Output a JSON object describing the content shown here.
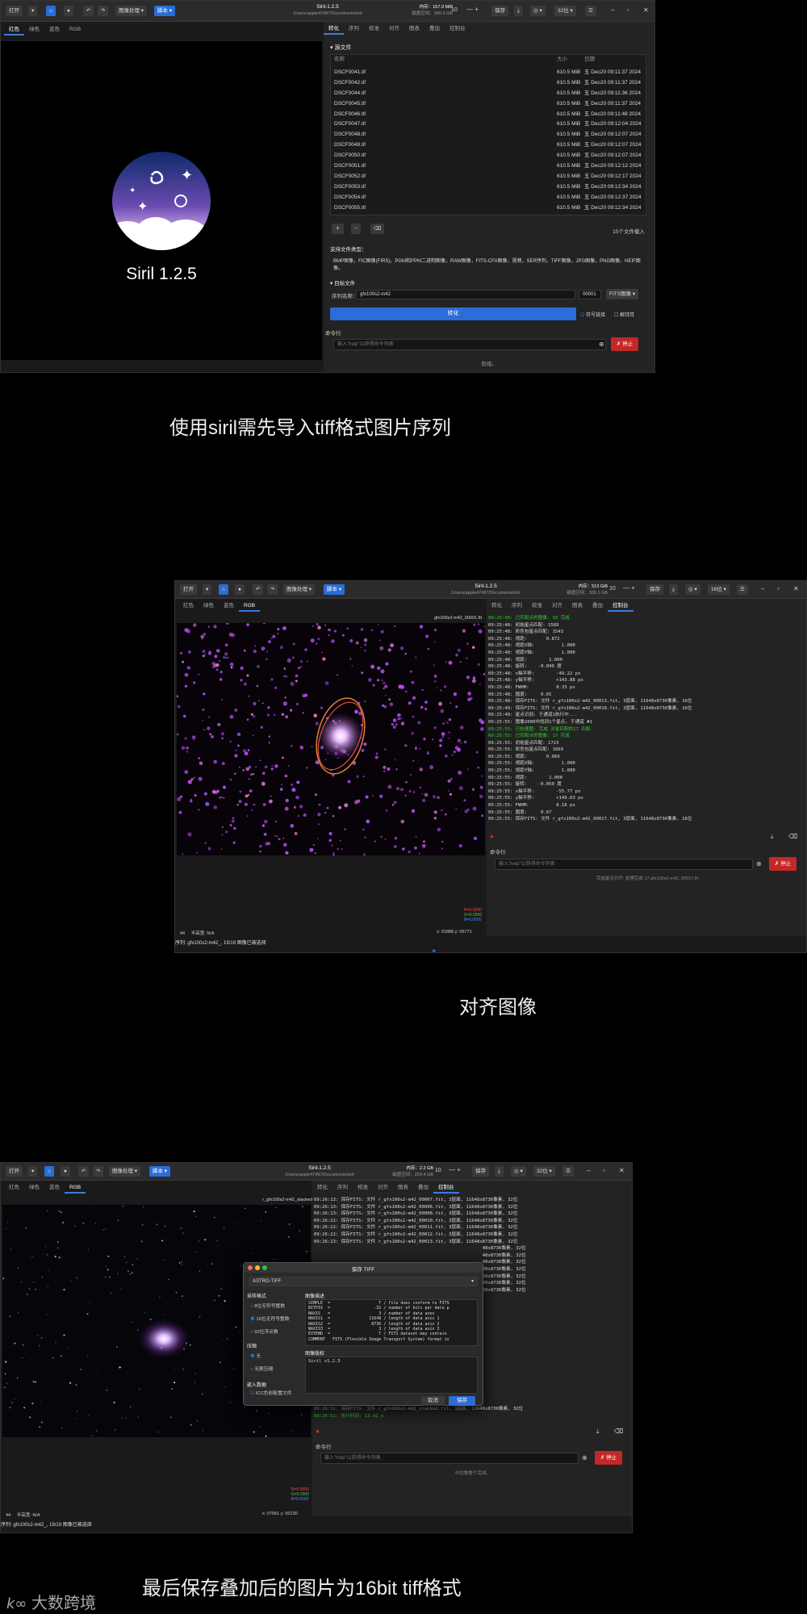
{
  "shared": {
    "open_label": "打开",
    "image_process_label": "图像处理",
    "script_label": "脚本",
    "save_label": "保存",
    "app_title": "Siril-1.2.5",
    "app_path": "/Users/apple47497/Documents/siril",
    "channel_tabs": [
      "红色",
      "绿色",
      "蓝色",
      "RGB"
    ],
    "right_tabs": [
      "转化",
      "序列",
      "校准",
      "对齐",
      "图表",
      "叠加",
      "控制台"
    ],
    "cmd_label": "命令行",
    "cmd_placeholder": "输入\"help\"以获得命令列表",
    "stop_label": "✗ 停止"
  },
  "section1": {
    "mem_text": "内存：157.9 MiB",
    "disk_text": "磁盘空间：349.3 GB",
    "threads": "10",
    "bits_label": "32位",
    "logo_text": "Siril 1.2.5",
    "source_files_label": "▾ 源文件",
    "col_name": "名称",
    "col_size": "大小",
    "col_date": "日期",
    "files": [
      {
        "name": "DSCF0041.tif",
        "size": "610.5 MiB",
        "date": "五 Dec20 09:11:37 2024"
      },
      {
        "name": "DSCF0042.tif",
        "size": "610.5 MiB",
        "date": "五 Dec20 09:11:37 2024"
      },
      {
        "name": "DSCF0044.tif",
        "size": "610.5 MiB",
        "date": "五 Dec20 09:11:36 2024"
      },
      {
        "name": "DSCF0045.tif",
        "size": "610.5 MiB",
        "date": "五 Dec20 09:11:37 2024"
      },
      {
        "name": "DSCF0046.tif",
        "size": "610.5 MiB",
        "date": "五 Dec20 09:11:48 2024"
      },
      {
        "name": "DSCF0047.tif",
        "size": "610.5 MiB",
        "date": "五 Dec20 09:12:04 2024"
      },
      {
        "name": "DSCF0048.tif",
        "size": "610.5 MiB",
        "date": "五 Dec20 09:12:07 2024"
      },
      {
        "name": "DSCF0049.tif",
        "size": "610.5 MiB",
        "date": "五 Dec20 09:12:07 2024"
      },
      {
        "name": "DSCF0050.tif",
        "size": "610.5 MiB",
        "date": "五 Dec20 09:12:07 2024"
      },
      {
        "name": "DSCF0051.tif",
        "size": "610.5 MiB",
        "date": "五 Dec20 09:12:12 2024"
      },
      {
        "name": "DSCF0052.tif",
        "size": "610.5 MiB",
        "date": "五 Dec20 09:12:17 2024"
      },
      {
        "name": "DSCF0053.tif",
        "size": "610.5 MiB",
        "date": "五 Dec20 09:12:34 2024"
      },
      {
        "name": "DSCF0054.tif",
        "size": "610.5 MiB",
        "date": "五 Dec20 09:12:37 2024"
      },
      {
        "name": "DSCF0055.tif",
        "size": "610.5 MiB",
        "date": "五 Dec20 09:12:34 2024"
      }
    ],
    "file_count": "15个文件载入",
    "supported_label": "支持文件类型：",
    "supported_text": "BMP图像，FIC图像(FIRS)，PGM和PPM二进制图像，RAW图像，FITS-CFA图像，视频，SER序列，TIFF图像，JPG图像，PNG图像，HEIF图像。",
    "output_label": "▾ 目标文件",
    "seq_name_label": "序列名称：",
    "seq_name_value": "gfx100s2-m42",
    "seq_index": "00001",
    "fits_label": "FITS图像",
    "convert_label": "转化",
    "symlink_label": "符号链接",
    "debayer_label": "解拜耳",
    "status": "就绪。"
  },
  "caption1": "使用siril需先导入tiff格式图片序列",
  "section2": {
    "mem_text": "内存：513 GiB",
    "disk_text": "磁盘空间：305.1 GB",
    "threads": "10",
    "bits_label": "16位",
    "image_title": "gfx100s2-m42_00001.fit",
    "log_lines": [
      {
        "t": "09:25:48: 已匹配点的图像: 33 完成",
        "g": true
      },
      {
        "t": "09:25:48: 初始星点匹配: 1589",
        "g": false
      },
      {
        "t": "09:25:48: 彩色包星点匹配: 1543",
        "g": false
      },
      {
        "t": "09:25:48: 视距:       0.872",
        "g": false
      },
      {
        "t": "09:25:48: 视距X轴:          1.000",
        "g": false
      },
      {
        "t": "09:25:48: 视距Y轴:          1.000",
        "g": false
      },
      {
        "t": "09:25:48: 视距:        1.000",
        "g": false
      },
      {
        "t": "09:25:48: 旋转:    -0.049 度",
        "g": false
      },
      {
        "t": "09:25:48: x轴平移:        -49.22 px",
        "g": false
      },
      {
        "t": "09:25:48: y轴平移:        +143.88 px",
        "g": false
      },
      {
        "t": "09:25:48: FWHM:          8.33 px",
        "g": false
      },
      {
        "t": "09:25:48: 圆度:     0.65",
        "g": false
      },
      {
        "t": "09:25:48: 保存FITS: 文件 r_gfx100s2-m42_00013.fit, 3层面, 11648x8736像素, 16位",
        "g": false
      },
      {
        "t": "09:25:49: 保存FITS: 文件 r_gfx100s2-m42_00018.fit, 3层面, 11648x8736像素, 16位",
        "g": false
      },
      {
        "t": "09:25:49: 星点识别: 于通道1执行中...",
        "g": false
      },
      {
        "t": "09:25:55: 图像2000中找到1个星点, 于通道 #1",
        "g": false
      },
      {
        "t": "09:25:55: 已处理图: 完成 对星匹配的17 匹配",
        "g": true
      },
      {
        "t": "09:25:55: 已匹配点的图像: 17 完成",
        "g": true
      },
      {
        "t": "09:25:55: 初始星点匹配: 1723",
        "g": false
      },
      {
        "t": "09:25:55: 彩色包星点匹配: 1669",
        "g": false
      },
      {
        "t": "09:25:55: 视距:       0.969",
        "g": false
      },
      {
        "t": "09:25:55: 视距X轴:          1.000",
        "g": false
      },
      {
        "t": "09:25:55: 视距Y轴:          1.000",
        "g": false
      },
      {
        "t": "09:25:55: 视距:        1.000",
        "g": false
      },
      {
        "t": "09:25:55: 旋转:    -0.050 度",
        "g": false
      },
      {
        "t": "09:25:55: x轴平移:        -55.77 px",
        "g": false
      },
      {
        "t": "09:25:55: y轴平移:        +149.63 px",
        "g": false
      },
      {
        "t": "09:25:55: FWHM:          8.18 px",
        "g": false
      },
      {
        "t": "09:25:55: 圆度:     0.67",
        "g": false
      },
      {
        "t": "09:25:55: 保存FITS: 文件 r_gfx100s2-m42_00017.fit, 3层面, 11648x8736像素, 16位",
        "g": false
      }
    ],
    "coords_left": "44     半高宽: N/A",
    "coords_right": "x: 01888 y: 06771",
    "status": "完成星点对齐: 处理完成 17 gfx100s2-m42_00017.fit",
    "seq_status": "序列: gfx100s2-m42_, 19/19 图像已被选择",
    "rgb_readout": [
      "R=0.0000",
      "G=0.0000",
      "B=0.0000"
    ]
  },
  "caption2": "对齐图像",
  "section3": {
    "mem_text": "内存：2.2 GB",
    "disk_text": "磁盘空间：250.4 GB",
    "threads": "10",
    "bits_label": "32位",
    "image_title": "r_gfx100s2-m42_stacked",
    "log_lines": [
      {
        "t": "09:26:13: 保存FITS: 文件 r_gfx100s2-m42_00007.fit, 3层面, 11648x8736像素, 32位",
        "g": false
      },
      {
        "t": "09:26:13: 保存FITS: 文件 r_gfx100s2-m42_00006.fit, 3层面, 11648x8736像素, 32位",
        "g": false
      },
      {
        "t": "09:26:13: 保存FITS: 文件 r_gfx100s2-m42_00008.fit, 3层面, 11648x8736像素, 32位",
        "g": false
      },
      {
        "t": "09:26:22: 保存FITS: 文件 r_gfx100s2-m42_00010.fit, 3层面, 11648x8736像素, 32位",
        "g": false
      },
      {
        "t": "09:26:22: 保存FITS: 文件 r_gfx100s2-m42_00011.fit, 3层面, 11648x8736像素, 32位",
        "g": false
      },
      {
        "t": "09:26:22: 保存FITS: 文件 r_gfx100s2-m42_00012.fit, 3层面, 11648x8736像素, 32位",
        "g": false
      },
      {
        "t": "09:26:23: 保存FITS: 文件 r_gfx100s2-m42_00013.fit, 3层面, 11648x8736像素, 32位",
        "g": false
      },
      {
        "t": "                                                              48x8736像素, 32位",
        "g": false
      },
      {
        "t": "                                                              48x8736像素, 32位",
        "g": false
      },
      {
        "t": "                                                              48x8736像素, 32位",
        "g": false
      },
      {
        "t": "                                                              48x8736像素, 32位",
        "g": false
      },
      {
        "t": "                                                              48x8736像素, 32位",
        "g": false
      },
      {
        "t": "                                                              48x8736像素, 32位",
        "g": false
      },
      {
        "t": "                                                              48x8736像素, 32位",
        "g": false
      }
    ],
    "log_bottom": [
      {
        "t": "09:26:51: 背景噪声值 (通道: #1) : 310.755 (7.542e-03)",
        "g": false
      },
      {
        "t": "09:26:51: 背景噪声值 (通道: #2) : 319.433 (7.358e-03)",
        "g": false
      },
      {
        "t": "09:26:52: 保存FITS: 文件 r_gfx100s2-m42_stacked.fit, 3层面, 11648x8736像素, 32位",
        "g": false
      },
      {
        "t": "09:26:52: 执行时间: 13.91 s",
        "g": true
      }
    ],
    "coords_left": "44     半高宽: N/A",
    "coords_right": "x: 07061 y: 00130",
    "status": "中位数整个完成。",
    "seq_status": "序列: gfx100s2-m42_, 19/19 图像已被选择",
    "rgb_readout": [
      "R=0.0000",
      "G=0.0000",
      "B=0.0000"
    ],
    "dialog": {
      "title": "保存 TIFF",
      "format": "ASTRO-TIFF",
      "sample_format_label": "采样格式",
      "sample_options": [
        "8位无符号整数",
        "16位无符号整数",
        "32位浮点数"
      ],
      "sample_selected": 1,
      "compression_label": "压缩",
      "compression_options": [
        "无",
        "无损压缩"
      ],
      "compression_selected": 0,
      "embed_label": "嵌入数据",
      "icc_label": "ICC色彩配置文件",
      "desc_label": "图像描述",
      "fits_header": "SIMPLE  =                    T / file does conform to FITS\nBITPIX  =                  -32 / number of bits per data p\nNAXIS   =                    3 / number of data axes\nNAXIS1  =                11648 / length of data axis 1\nNAXIS2  =                 8736 / length of data axis 2\nNAXIS3  =                    3 / length of data axis 3\nEXTEND  =                    T / FITS dataset may contain\nCOMMENT   FITS (Flexible Image Transport System) format is",
      "copyright_label": "图像版权",
      "copyright_value": "Siril v1.2.5",
      "cancel_label": "取消",
      "save_label": "保存"
    }
  },
  "caption3": "最后保存叠加后的图片为16bit tiff格式",
  "watermark": "大数跨境"
}
